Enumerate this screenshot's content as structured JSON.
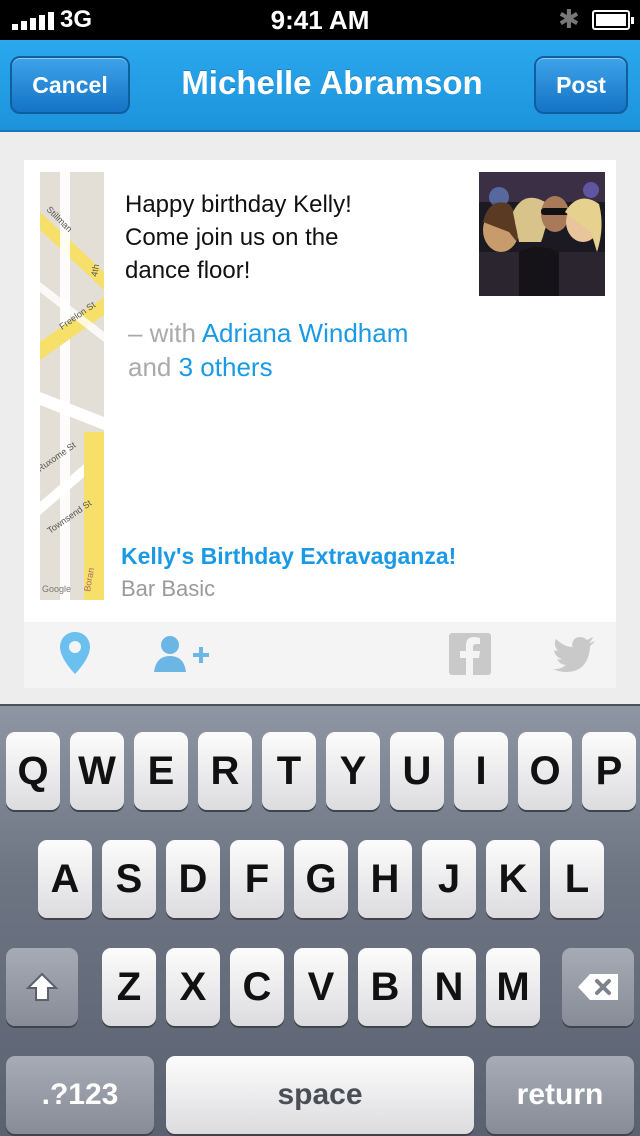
{
  "status_bar": {
    "network": "3G",
    "time": "9:41 AM"
  },
  "nav": {
    "cancel_label": "Cancel",
    "title": "Michelle Abramson",
    "post_label": "Post"
  },
  "post": {
    "text_lines": [
      "Happy birthday Kelly!",
      "Come join us on the",
      "dance floor!"
    ],
    "with_prefix": "– with",
    "with_person": "Adriana Windham",
    "and_word": "and",
    "others_link": "3 others",
    "place_name": "Kelly's Birthday Extravaganza!",
    "place_sub": "Bar Basic"
  },
  "map_labels": [
    "Stillman",
    "Freelon St",
    "Ruxome St",
    "Townsend St",
    "Google",
    "Boran",
    "4th"
  ],
  "toolbar_icons": [
    "location-pin-icon",
    "add-person-icon",
    "facebook-icon",
    "twitter-icon"
  ],
  "keyboard": {
    "row1": [
      "Q",
      "W",
      "E",
      "R",
      "T",
      "Y",
      "U",
      "I",
      "O",
      "P"
    ],
    "row2": [
      "A",
      "S",
      "D",
      "F",
      "G",
      "H",
      "J",
      "K",
      "L"
    ],
    "row3": [
      "Z",
      "X",
      "C",
      "V",
      "B",
      "N",
      "M"
    ],
    "numbers_label": ".?123",
    "space_label": "space",
    "return_label": "return"
  },
  "colors": {
    "accent": "#1a9ae6",
    "nav_blue": "#1d93dc"
  }
}
